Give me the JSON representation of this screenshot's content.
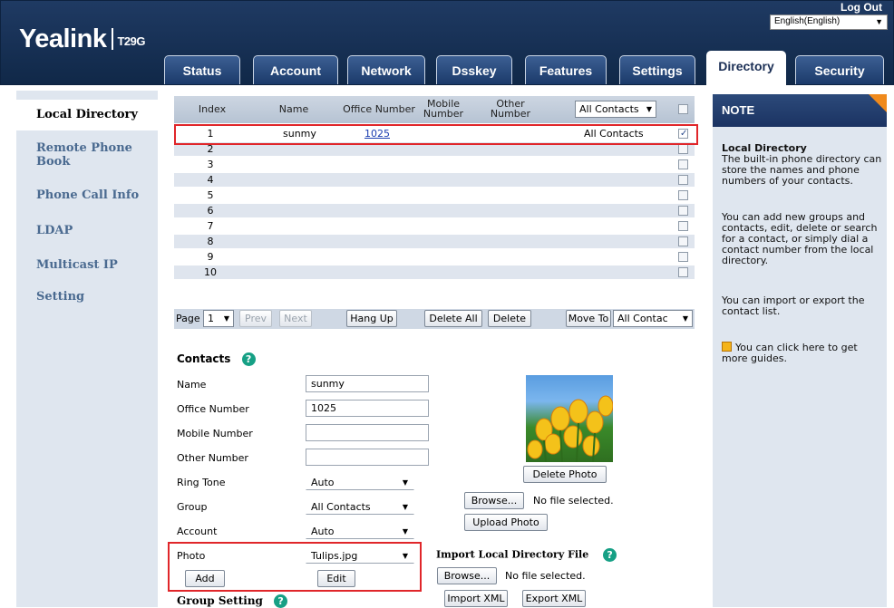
{
  "header": {
    "logo_brand": "Yealink",
    "logo_model": "T29G",
    "logout": "Log Out",
    "language": "English(English)"
  },
  "tabs": [
    "Status",
    "Account",
    "Network",
    "Dsskey",
    "Features",
    "Settings",
    "Directory",
    "Security"
  ],
  "active_tab": "Directory",
  "sidebar": {
    "items": [
      "Local Directory",
      "Remote Phone Book",
      "Phone Call Info",
      "LDAP",
      "Multicast IP",
      "Setting"
    ]
  },
  "table": {
    "headers": {
      "index": "Index",
      "name": "Name",
      "office": "Office Number",
      "mobile": "Mobile Number",
      "other": "Other Number"
    },
    "group_filter": "All Contacts",
    "rows": [
      {
        "index": "1",
        "name": "sunmy",
        "office": "1025",
        "group": "All Contacts",
        "checked": true
      },
      {
        "index": "2"
      },
      {
        "index": "3"
      },
      {
        "index": "4"
      },
      {
        "index": "5"
      },
      {
        "index": "6"
      },
      {
        "index": "7"
      },
      {
        "index": "8"
      },
      {
        "index": "9"
      },
      {
        "index": "10"
      }
    ]
  },
  "pager": {
    "page_label": "Page",
    "page": "1",
    "prev": "Prev",
    "next": "Next",
    "hang_up": "Hang Up",
    "delete_all": "Delete All",
    "delete": "Delete",
    "move_to": "Move To",
    "move_group": "All Contac"
  },
  "contacts": {
    "title": "Contacts",
    "name_label": "Name",
    "name_value": "sunmy",
    "office_label": "Office Number",
    "office_value": "1025",
    "mobile_label": "Mobile Number",
    "mobile_value": "",
    "other_label": "Other Number",
    "other_value": "",
    "ring_label": "Ring Tone",
    "ring_value": "Auto",
    "group_label": "Group",
    "group_value": "All Contacts",
    "account_label": "Account",
    "account_value": "Auto",
    "photo_label": "Photo",
    "photo_value": "Tulips.jpg",
    "add": "Add",
    "edit": "Edit",
    "delete_photo": "Delete Photo",
    "browse": "Browse...",
    "no_file": "No file selected.",
    "upload_photo": "Upload Photo"
  },
  "import": {
    "title": "Import Local Directory File",
    "browse": "Browse...",
    "no_file": "No file selected.",
    "import_xml": "Import XML",
    "export_xml": "Export XML"
  },
  "group_setting": "Group Setting",
  "note": {
    "title": "NOTE",
    "heading": "Local Directory",
    "p1": "The built-in phone directory can store the names and phone numbers of your contacts.",
    "p2": "You can add new groups and contacts, edit, delete or search for a contact, or simply dial a contact number from the local directory.",
    "p3": "You can import or export the contact list.",
    "p4": "You can click here to get more guides."
  },
  "colors": {
    "header": "#1b3a6a",
    "highlight": "#e0262a",
    "accent": "#f08a1c"
  }
}
